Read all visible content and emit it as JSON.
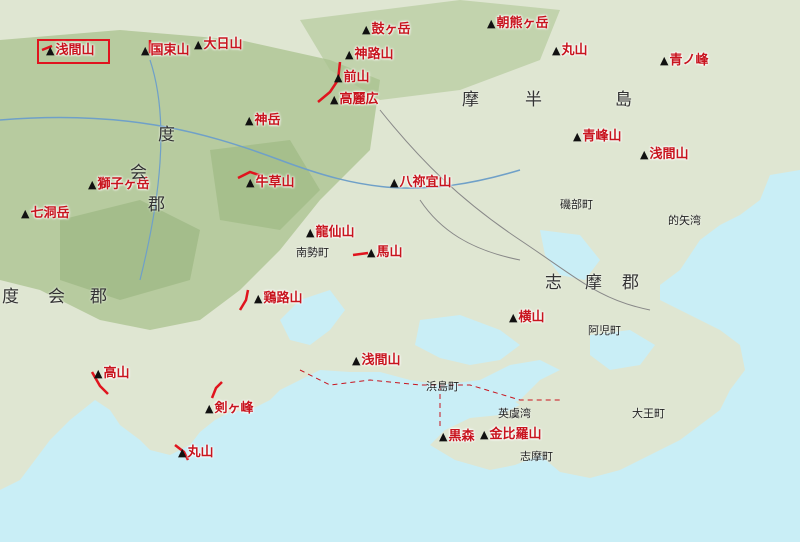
{
  "map": {
    "colors": {
      "sea": "#c9eef6",
      "land": "#dfe6d2",
      "mountain": "#a9c28e",
      "peak_label": "#c8141e",
      "trail": "#e0141e",
      "highlight": "#e0141e"
    },
    "highlighted_peak": "浅間山",
    "peaks": [
      {
        "name": "浅間山",
        "id": "asama-nw"
      },
      {
        "name": "国束山",
        "id": "kunitsuka"
      },
      {
        "name": "大日山",
        "id": "dainichi"
      },
      {
        "name": "鼓ヶ岳",
        "id": "tsuzumigatake"
      },
      {
        "name": "朝熊ヶ岳",
        "id": "asamagatake"
      },
      {
        "name": "神路山",
        "id": "kamiji"
      },
      {
        "name": "前山",
        "id": "maeyama"
      },
      {
        "name": "高麗広",
        "id": "koraibiro"
      },
      {
        "name": "丸山",
        "id": "maruyama-ne"
      },
      {
        "name": "青ノ峰",
        "id": "aonomine"
      },
      {
        "name": "神岳",
        "id": "kamitake"
      },
      {
        "name": "青峰山",
        "id": "aominesan"
      },
      {
        "name": "浅間山",
        "id": "asama-e"
      },
      {
        "name": "獅子ヶ岳",
        "id": "shishigatake"
      },
      {
        "name": "牛草山",
        "id": "ushikusa"
      },
      {
        "name": "八祢宜山",
        "id": "hachinegi"
      },
      {
        "name": "七洞岳",
        "id": "nanahora"
      },
      {
        "name": "龍仙山",
        "id": "ryusen"
      },
      {
        "name": "馬山",
        "id": "umayama"
      },
      {
        "name": "鶏路山",
        "id": "keiro"
      },
      {
        "name": "横山",
        "id": "yokoyama"
      },
      {
        "name": "浅間山",
        "id": "asama-s"
      },
      {
        "name": "高山",
        "id": "takayama"
      },
      {
        "name": "剣ヶ峰",
        "id": "tsurugigamine"
      },
      {
        "name": "丸山",
        "id": "maruyama-s"
      },
      {
        "name": "黒森",
        "id": "kuromori"
      },
      {
        "name": "金比羅山",
        "id": "konpira"
      }
    ],
    "regions": [
      {
        "text": "度",
        "id": "wata-1"
      },
      {
        "text": "会",
        "id": "wata-2"
      },
      {
        "text": "郡",
        "id": "wata-3"
      },
      {
        "text": "志",
        "id": "shima-1"
      },
      {
        "text": "摩",
        "id": "shima-2"
      },
      {
        "text": "郡",
        "id": "shima-3"
      },
      {
        "text": "摩",
        "id": "hanto-1"
      },
      {
        "text": "半",
        "id": "hanto-2"
      },
      {
        "text": "島",
        "id": "hanto-3"
      },
      {
        "text": "度",
        "id": "wata-b-1"
      },
      {
        "text": "会",
        "id": "wata-b-2"
      },
      {
        "text": "郡",
        "id": "wata-b-3"
      }
    ],
    "towns": [
      {
        "text": "磯部町",
        "id": "isobe"
      },
      {
        "text": "阿児町",
        "id": "ago"
      },
      {
        "text": "浜島町",
        "id": "hamajima"
      },
      {
        "text": "大王町",
        "id": "daio"
      },
      {
        "text": "南勢町",
        "id": "nansei"
      },
      {
        "text": "英虞湾",
        "id": "agowan"
      },
      {
        "text": "志摩町",
        "id": "shima-cho"
      },
      {
        "text": "的矢湾",
        "id": "matoya"
      }
    ]
  }
}
